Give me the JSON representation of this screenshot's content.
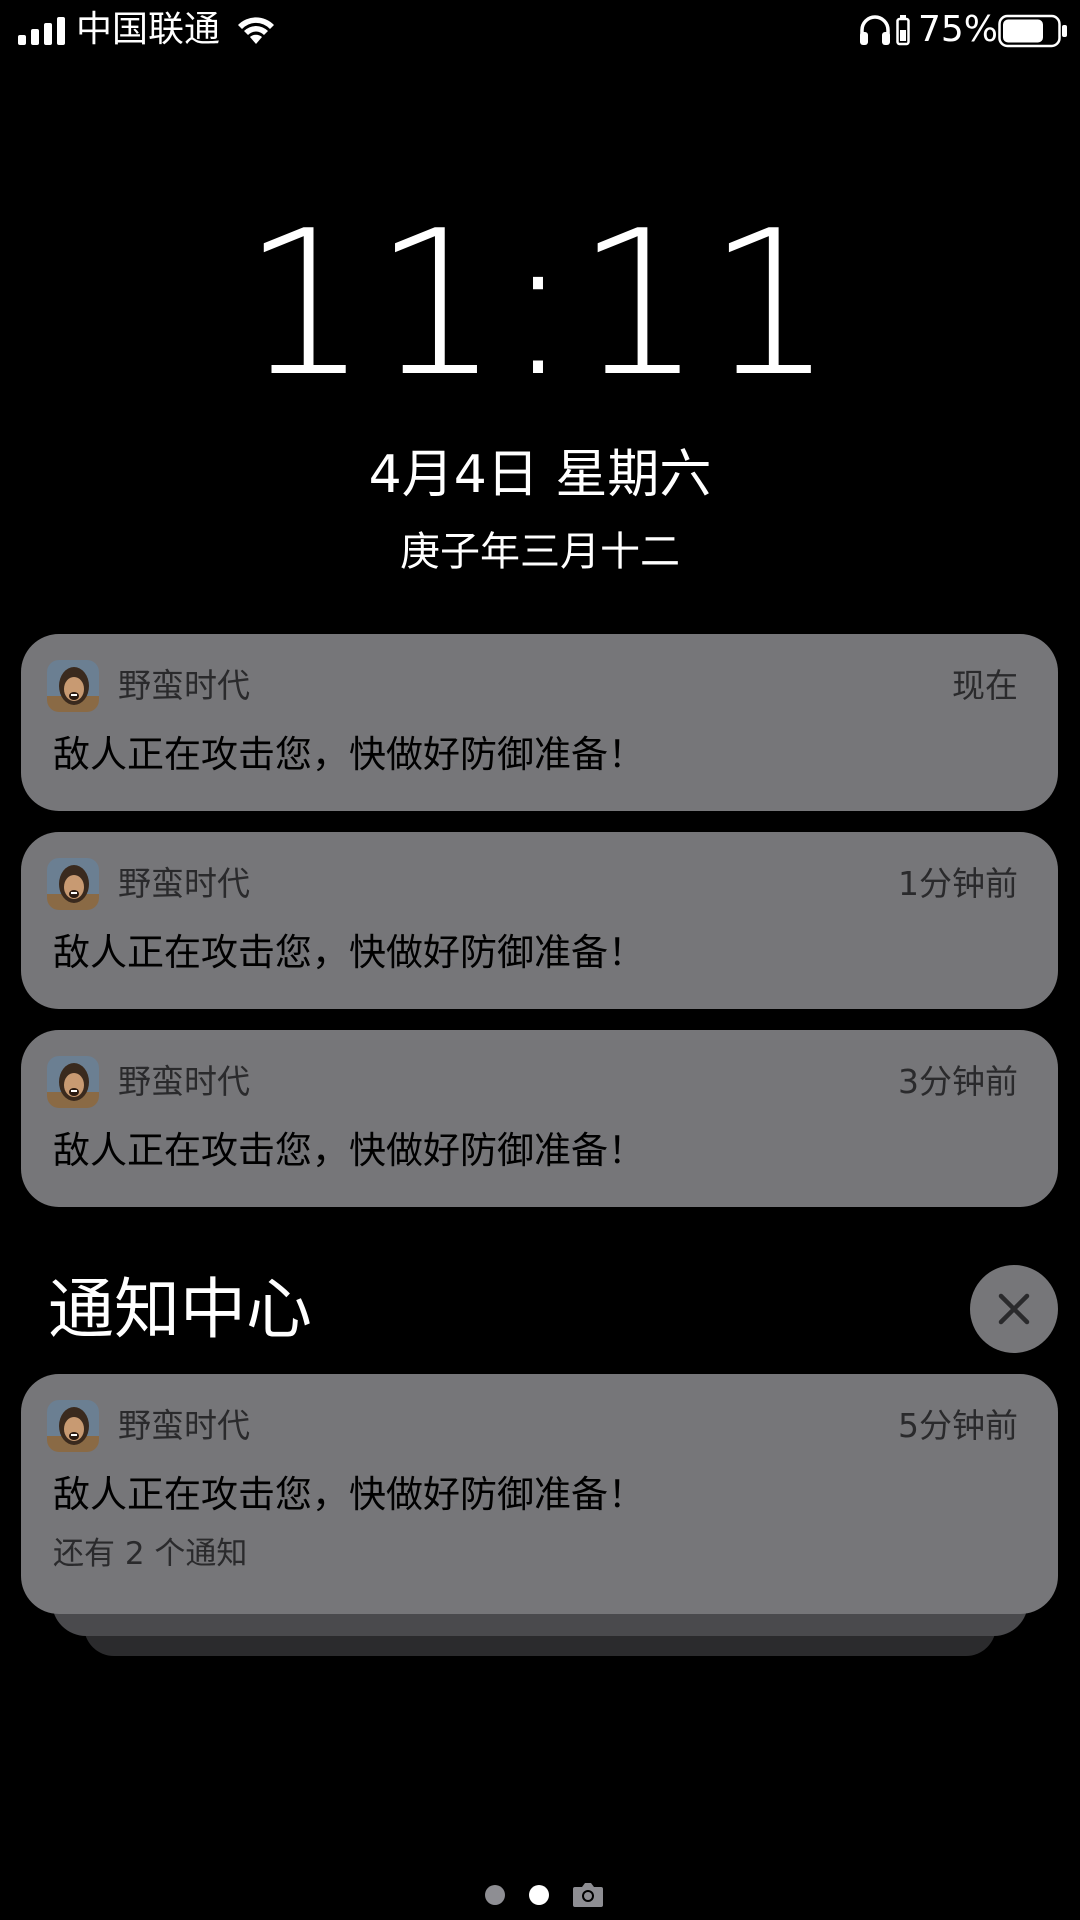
{
  "status_bar": {
    "carrier": "中国联通",
    "battery_percent": "75%",
    "battery_level": 0.75,
    "icons": [
      "signal-icon",
      "wifi-icon",
      "headphones-icon",
      "charging-icon",
      "battery-icon"
    ]
  },
  "lock_screen": {
    "time": "11:11",
    "date": "4月4日 星期六",
    "lunar_date": "庚子年三月十二"
  },
  "notifications": [
    {
      "app_name": "野蛮时代",
      "time": "现在",
      "message": "敌人正在攻击您，快做好防御准备！"
    },
    {
      "app_name": "野蛮时代",
      "time": "1分钟前",
      "message": "敌人正在攻击您，快做好防御准备！"
    },
    {
      "app_name": "野蛮时代",
      "time": "3分钟前",
      "message": "敌人正在攻击您，快做好防御准备！"
    }
  ],
  "notification_center": {
    "title": "通知中心",
    "clear_icon": "close-icon",
    "stacked_notification": {
      "app_name": "野蛮时代",
      "time": "5分钟前",
      "message": "敌人正在攻击您，快做好防御准备！",
      "more": "还有 2 个通知"
    }
  },
  "page_indicator": {
    "page_count": 2,
    "current_page": 2,
    "trailing_icon": "camera-icon"
  },
  "colors": {
    "background": "#000000",
    "notification_bg": "#767679",
    "secondary_text": "#2a2a2c"
  }
}
